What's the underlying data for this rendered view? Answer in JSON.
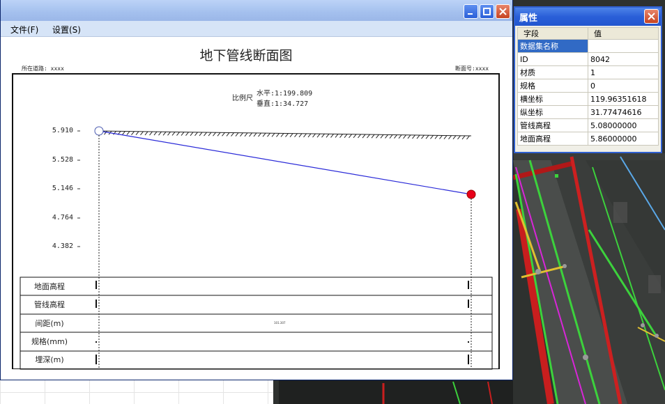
{
  "menu": {
    "file": "文件(F)",
    "settings": "设置(S)"
  },
  "report": {
    "title": "地下管线断面图",
    "road_label": "所在道路: xxxx",
    "section_label": "断面号:xxxx",
    "scale_label": "比例尺",
    "scale_h": "水平:1:199.809",
    "scale_v": "垂直:1:34.727",
    "y_ticks": [
      "5.910",
      "5.528",
      "5.146",
      "4.764",
      "4.382"
    ],
    "rows": [
      "地面高程",
      "管线高程",
      "间距(m)",
      "规格(mm)",
      "埋深(m)"
    ],
    "spacing_value": "101.307"
  },
  "props": {
    "title": "属性",
    "col_field": "字段",
    "col_value": "值",
    "rows": [
      {
        "field": "数据集名称",
        "value": ""
      },
      {
        "field": "ID",
        "value": "8042"
      },
      {
        "field": "材质",
        "value": "1"
      },
      {
        "field": "规格",
        "value": "0"
      },
      {
        "field": "横坐标",
        "value": "119.96351618"
      },
      {
        "field": "纵坐标",
        "value": "31.77474616"
      },
      {
        "field": "管线高程",
        "value": "5.08000000"
      },
      {
        "field": "地面高程",
        "value": "5.86000000"
      }
    ]
  },
  "colors": {
    "pipe": "#2a2ad8",
    "node_end": "#e8001a",
    "map_green": "#3cd23c",
    "map_red": "#d42020"
  },
  "icons": [
    "minimize-icon",
    "maximize-icon",
    "close-icon"
  ]
}
